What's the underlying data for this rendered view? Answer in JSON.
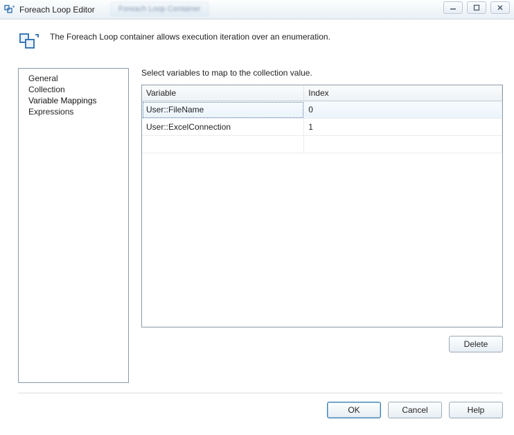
{
  "window": {
    "title": "Foreach Loop Editor",
    "background_tab": "Foreach Loop Container"
  },
  "header": {
    "description": "The Foreach Loop container allows execution iteration over an enumeration."
  },
  "sidebar": {
    "items": [
      {
        "label": "General"
      },
      {
        "label": "Collection"
      },
      {
        "label": "Variable Mappings"
      },
      {
        "label": "Expressions"
      }
    ],
    "selected_index": 2
  },
  "mapping": {
    "instruction": "Select variables to map to the collection value.",
    "columns": {
      "variable": "Variable",
      "index": "Index"
    },
    "rows": [
      {
        "variable": "User::FileName",
        "index": "0"
      },
      {
        "variable": "User::ExcelConnection",
        "index": "1"
      }
    ]
  },
  "buttons": {
    "delete": "Delete",
    "ok": "OK",
    "cancel": "Cancel",
    "help": "Help"
  }
}
